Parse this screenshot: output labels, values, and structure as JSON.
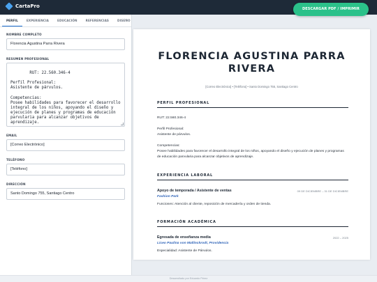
{
  "app": {
    "name": "CartaPro",
    "download_label": "DESCARGAR PDF / IMPRIMIR",
    "accent": "#2bc18a",
    "header_bg": "#1e2a38"
  },
  "tabs": [
    {
      "label": "PERFIL",
      "active": true
    },
    {
      "label": "EXPERIENCIA"
    },
    {
      "label": "EDUCACIÓN"
    },
    {
      "label": "REFERENCIAS"
    },
    {
      "label": "DISEÑO"
    }
  ],
  "form": {
    "name_label": "NOMBRE COMPLETO",
    "name_value": "Florencia Agustina Parra Rivera",
    "summary_label": "RESUMEN PROFESIONAL",
    "summary_value": "RUT: 22.560.346-4\n\nPerfil Profesional:\nAsistente de párvulos.\n\nCompetencias:\nPosee habilidades para favorecer el desarrollo integral de los niños, apoyando el diseño y ejecución de planes y programas de educación parvularia para alcanzar objetivos de aprendizaje.",
    "email_label": "EMAIL",
    "email_value": "[Correo Electrónico]",
    "phone_label": "TELÉFONO",
    "phone_value": "[Teléfono]",
    "address_label": "DIRECCIÓN",
    "address_value": "Santo Domingo 755, Santiago Centro"
  },
  "preview": {
    "name_line1": "FLORENCIA AGUSTINA PARRA",
    "name_line2": "RIVERA",
    "contact": "[Correo Electrónico] • [Teléfono] • Santo Domingo 755, Santiago Centro",
    "profile_title": "PERFIL PROFESIONAL",
    "profile_rut": "RUT: 22.560.346-4",
    "profile_heading": "Perfil Profesional:",
    "profile_role": "Asistente de párvulos.",
    "competencies_heading": "Competencias:",
    "competencies_text": "Posee habilidades para favorecer el desarrollo integral de los niños, apoyando el diseño y ejecución de planes y programas de educación parvularia para alcanzar objetivos de aprendizaje.",
    "experience_title": "EXPERIENCIA LABORAL",
    "experience": {
      "title": "Apoyo de temporada / Asistente de ventas",
      "dates": "09 DE DICIEMBRE – 31 DE DICIEMBRE",
      "company": "Fashion Park",
      "description": "Funciones: Atención al cliente, reposición de mercadería y orden de tienda."
    },
    "education_title": "FORMACIÓN ACADÉMICA",
    "education": {
      "title": "Egresada de enseñanza media",
      "dates": "2022 – 2025",
      "school": "Liceo Paulina von Mallinckrodt, Providencia",
      "specialty": "Especialidad: Asistente de Párvulos."
    }
  },
  "footer": {
    "text": "Desarrollado por Eduardo Pérez"
  }
}
